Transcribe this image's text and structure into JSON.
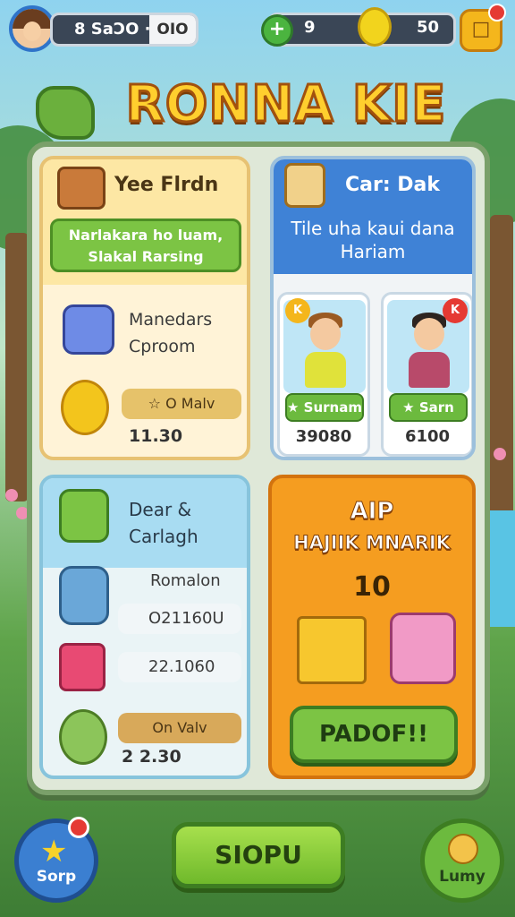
{
  "top_bar": {
    "coins_text": "8 SaƆO ·",
    "coins_box": "OIO",
    "gem_value": "9",
    "lemon_value": "50",
    "gem_symbol": "+",
    "menu_symbol": "□"
  },
  "title": "RONNA KIE",
  "cards": {
    "yellow": {
      "title": "Yee Flrdn",
      "banner": "Narlakara ho luam, Slakal Rarsing",
      "row1": "Manedars Cproom",
      "pill": "☆ O Malv",
      "value": "11.30"
    },
    "blue": {
      "title": "Car: Dak",
      "banner": "Tile uha kaui dana Hariam",
      "characters": [
        {
          "badge": "K",
          "name": "★ Surnam",
          "score": "39080"
        },
        {
          "badge": "K",
          "name": "★ Sarn",
          "score": "6100"
        }
      ]
    },
    "lightblue": {
      "title": "Dear & Carlagh",
      "row1": "Romalon",
      "row2": "O21160U",
      "row3": "22.1060",
      "pill": "On Valv",
      "value": "2 2.30"
    },
    "orange": {
      "title_top": "AIP",
      "title_bottom": "HAJIIK MNARIK",
      "count": "10",
      "button": "PADOF!!"
    }
  },
  "bottom": {
    "left_label": "Sorp",
    "center_label": "SIOPU",
    "right_label": "Lumy"
  },
  "colors": {
    "title_fill": "#ffcf2e",
    "green_button": "#7cc444",
    "orange_card": "#f59d20",
    "blue_head": "#3f82d6"
  }
}
